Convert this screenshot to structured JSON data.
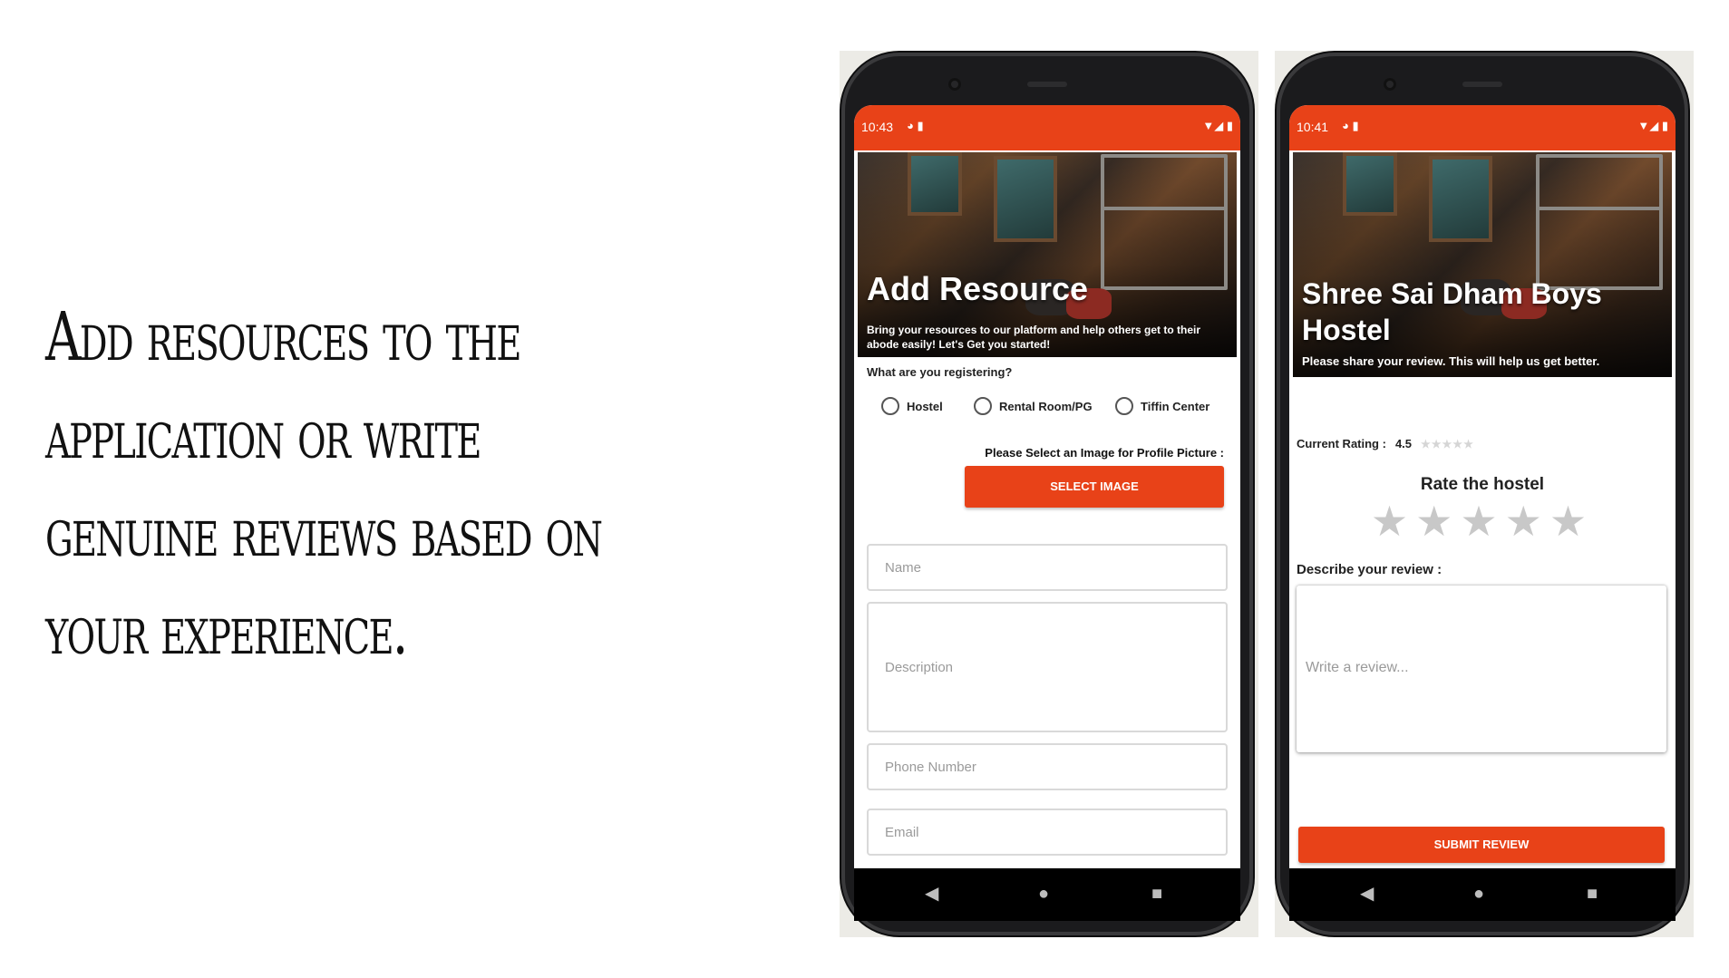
{
  "headline": "Add resources to the application or write genuine reviews based on your experience.",
  "brand_color": "#e84218",
  "left_phone": {
    "status_time": "10:43",
    "hero_title": "Add Resource",
    "hero_subtitle": "Bring your resources to our platform and help others get to their abode easily! Let's Get you started!",
    "question": "What are you registering?",
    "options": [
      "Hostel",
      "Rental Room/PG",
      "Tiffin Center"
    ],
    "image_label": "Please Select an Image for Profile Picture :",
    "select_button": "SELECT IMAGE",
    "fields": {
      "name": "Name",
      "description": "Description",
      "phone": "Phone Number",
      "email": "Email"
    }
  },
  "right_phone": {
    "status_time": "10:41",
    "hero_title": "Shree Sai Dham Boys Hostel",
    "hero_subtitle": "Please share your review. This will help us get better.",
    "rating_label": "Current Rating :",
    "rating_value": "4.5",
    "rate_title": "Rate the hostel",
    "describe_label": "Describe your review :",
    "review_placeholder": "Write a review...",
    "submit_button": "SUBMIT REVIEW"
  }
}
